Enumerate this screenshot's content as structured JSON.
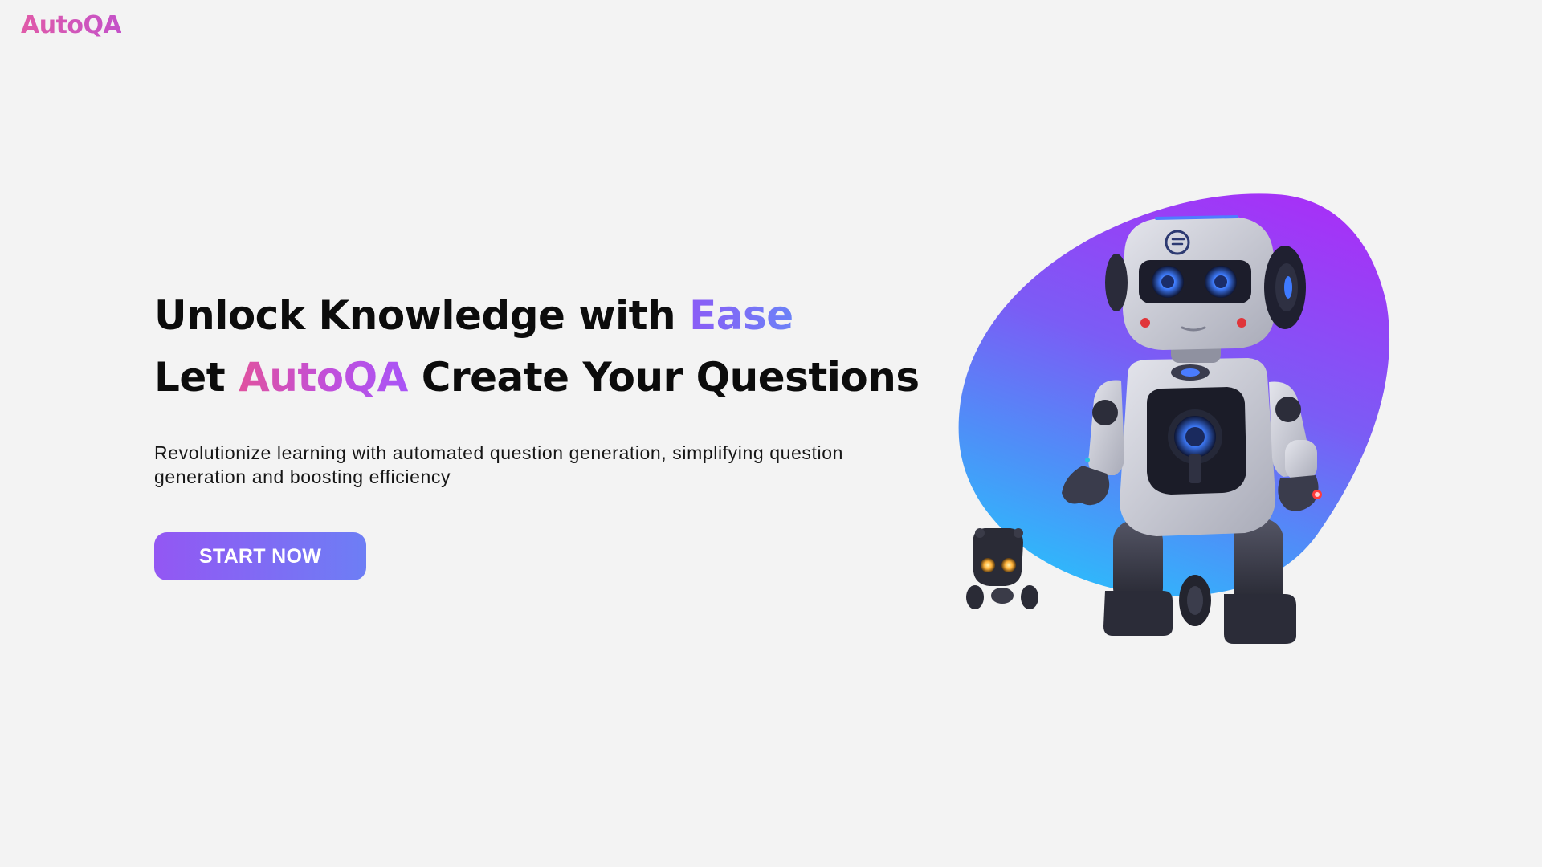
{
  "header": {
    "brand": "AutoQA"
  },
  "hero": {
    "line1_prefix": "Unlock Knowledge with ",
    "line1_highlight": "Ease",
    "line2_prefix": "Let ",
    "line2_highlight": "AutoQA",
    "line2_suffix": " Create Your Questions",
    "subtitle": "Revolutionize learning with automated question generation, simplifying question generation and boosting efficiency",
    "cta_label": "START NOW"
  },
  "illustration": {
    "icon": "robot-illustration-icon",
    "secondary_icon": "small-robot-icon",
    "blob_gradient": [
      "#a532f7",
      "#7b5cf5",
      "#4f8ef8",
      "#2fb8fb"
    ]
  },
  "colors": {
    "background": "#f3f3f3",
    "brand_pink": "#e05aa8",
    "accent_purple": "#8b5cf6",
    "accent_blue": "#6d7ef5",
    "text_dark": "#0c0c0c"
  }
}
